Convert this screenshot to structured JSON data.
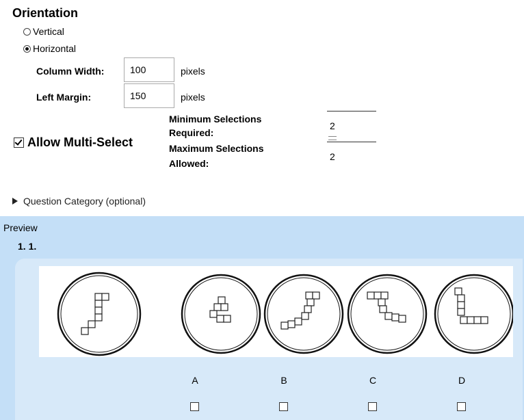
{
  "orientation": {
    "heading": "Orientation",
    "options": [
      {
        "label": "Vertical",
        "selected": false
      },
      {
        "label": "Horizontal",
        "selected": true
      }
    ]
  },
  "column_width": {
    "label": "Column Width:",
    "value": "100",
    "unit": "pixels"
  },
  "left_margin": {
    "label": "Left Margin:",
    "value": "150",
    "unit": "pixels"
  },
  "multi_select": {
    "label": "Allow Multi-Select",
    "checked": true,
    "min_label_1": "Minimum Selections",
    "min_label_2": "Required:",
    "min_value": "2",
    "max_label_1": "Maximum Selections",
    "max_label_2": "Allowed:",
    "max_value": "2"
  },
  "question_category": {
    "label": "Question Category (optional)"
  },
  "preview": {
    "label": "Preview",
    "question_number": "1. 1.",
    "figure_icons": [
      "reference-circle-icon",
      "option-circle-icon"
    ],
    "answer_options": [
      "A",
      "B",
      "C",
      "D"
    ]
  }
}
